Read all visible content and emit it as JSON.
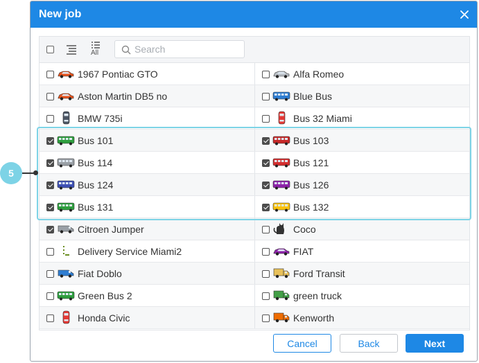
{
  "dialog": {
    "title": "New job",
    "search": {
      "placeholder": "Search",
      "value": ""
    },
    "toolbar": {
      "show_all_label": "All"
    },
    "units": [
      {
        "left": {
          "name": "1967 Pontiac GTO",
          "checked": false,
          "icon": "car-icon",
          "color": "#e8541e"
        },
        "right": {
          "name": "Alfa Romeo",
          "checked": false,
          "icon": "car-icon",
          "color": "#b9bec4"
        }
      },
      {
        "left": {
          "name": "Aston Martin DB5 no",
          "checked": false,
          "icon": "car-icon",
          "color": "#e8541e"
        },
        "right": {
          "name": "Blue Bus",
          "checked": false,
          "icon": "bus-icon",
          "color": "#2f7dd1"
        }
      },
      {
        "left": {
          "name": "BMW 735i",
          "checked": false,
          "icon": "car-top-icon",
          "color": "#4b5563"
        },
        "right": {
          "name": "Bus 32 Miami",
          "checked": false,
          "icon": "car-top-icon",
          "color": "#e53935"
        }
      },
      {
        "left": {
          "name": "Bus 101",
          "checked": true,
          "icon": "bus-icon",
          "color": "#2e9e3e"
        },
        "right": {
          "name": "Bus 103",
          "checked": true,
          "icon": "bus-icon",
          "color": "#c62828"
        }
      },
      {
        "left": {
          "name": "Bus 114",
          "checked": true,
          "icon": "bus-icon",
          "color": "#9aa0a6"
        },
        "right": {
          "name": "Bus 121",
          "checked": true,
          "icon": "bus-icon",
          "color": "#d32f2f"
        }
      },
      {
        "left": {
          "name": "Bus 124",
          "checked": true,
          "icon": "bus-icon",
          "color": "#3f51b5"
        },
        "right": {
          "name": "Bus 126",
          "checked": true,
          "icon": "bus-icon",
          "color": "#8e24aa"
        }
      },
      {
        "left": {
          "name": "Bus 131",
          "checked": true,
          "icon": "bus-icon",
          "color": "#2e9e3e"
        },
        "right": {
          "name": "Bus 132",
          "checked": true,
          "icon": "bus-icon",
          "color": "#f9c10b"
        }
      },
      {
        "left": {
          "name": "Citroen Jumper",
          "checked": true,
          "icon": "van-icon",
          "color": "#9aa0a6"
        },
        "right": {
          "name": "Coco",
          "checked": false,
          "icon": "cat-icon",
          "color": "#333333"
        }
      },
      {
        "left": {
          "name": "Delivery Service Miami2",
          "checked": false,
          "icon": "person-icon",
          "color": "#6b8e23"
        },
        "right": {
          "name": "FIAT",
          "checked": false,
          "icon": "car-icon",
          "color": "#8e24aa"
        }
      },
      {
        "left": {
          "name": "Fiat Doblo",
          "checked": false,
          "icon": "van-icon",
          "color": "#2f7dd1"
        },
        "right": {
          "name": "Ford Transit",
          "checked": false,
          "icon": "truck-icon",
          "color": "#e8c15a"
        }
      },
      {
        "left": {
          "name": "Green Bus 2",
          "checked": false,
          "icon": "bus-icon",
          "color": "#2e9e3e"
        },
        "right": {
          "name": "green truck",
          "checked": false,
          "icon": "truck-icon",
          "color": "#43a047"
        }
      },
      {
        "left": {
          "name": "Honda Civic",
          "checked": false,
          "icon": "car-top-icon",
          "color": "#e53935"
        },
        "right": {
          "name": "Kenworth",
          "checked": false,
          "icon": "truck-icon",
          "color": "#ef6c00"
        }
      }
    ],
    "callout": {
      "number": "5"
    },
    "buttons": {
      "cancel": "Cancel",
      "back": "Back",
      "next": "Next"
    },
    "colors": {
      "accent": "#1e88e5",
      "highlight": "#7dd3e6"
    }
  }
}
